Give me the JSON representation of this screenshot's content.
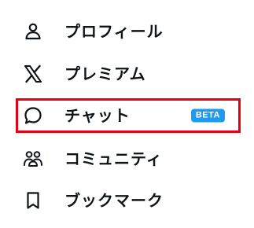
{
  "menu": {
    "items": [
      {
        "label": "プロフィール",
        "icon": "person-icon"
      },
      {
        "label": "プレミアム",
        "icon": "x-logo-icon"
      },
      {
        "label": "チャット",
        "icon": "chat-bubble-icon",
        "badge": "BETA",
        "highlighted": true
      },
      {
        "label": "コミュニティ",
        "icon": "community-icon"
      },
      {
        "label": "ブックマーク",
        "icon": "bookmark-icon"
      }
    ]
  },
  "colors": {
    "text": "#0f1419",
    "highlight_border": "#e60012",
    "badge_background": "#1d9bf0",
    "badge_text": "#ffffff",
    "background": "#ffffff"
  }
}
